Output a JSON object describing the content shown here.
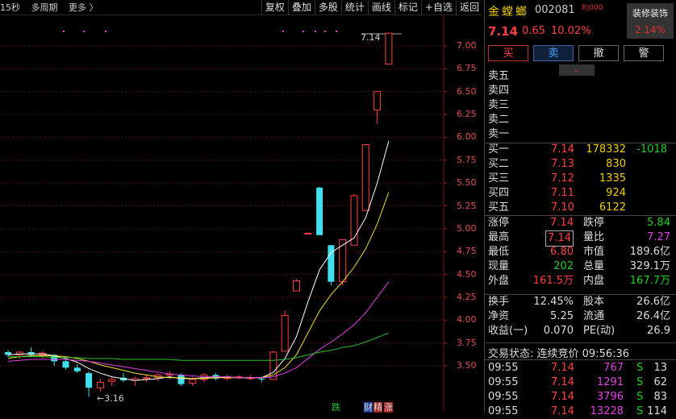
{
  "toolbar": {
    "left": [
      "15秒",
      "多周期",
      "更多 〉"
    ],
    "right": [
      "复权",
      "叠加",
      "多股",
      "统计",
      "画线",
      "+自选",
      "返回"
    ],
    "marker": "标记"
  },
  "chart": {
    "y_ticks": [
      "7.00",
      "6.75",
      "6.50",
      "6.25",
      "6.00",
      "5.75",
      "5.50",
      "5.25",
      "5.00",
      "4.75",
      "4.50",
      "4.25",
      "4.00",
      "3.75",
      "3.50"
    ],
    "high_label": "7.14",
    "low_label": "3.16",
    "bottom_tags": {
      "die": "跌",
      "cai": "财",
      "jing": "精",
      "zhang": "涨"
    }
  },
  "chart_data": {
    "type": "candlestick",
    "ylim": [
      3.3,
      7.3
    ],
    "candles": [
      {
        "o": 3.65,
        "h": 3.67,
        "l": 3.6,
        "c": 3.62
      },
      {
        "o": 3.62,
        "h": 3.66,
        "l": 3.58,
        "c": 3.65
      },
      {
        "o": 3.65,
        "h": 3.7,
        "l": 3.6,
        "c": 3.62
      },
      {
        "o": 3.62,
        "h": 3.66,
        "l": 3.58,
        "c": 3.64
      },
      {
        "o": 3.62,
        "h": 3.63,
        "l": 3.5,
        "c": 3.55
      },
      {
        "o": 3.55,
        "h": 3.58,
        "l": 3.46,
        "c": 3.48
      },
      {
        "o": 3.48,
        "h": 3.52,
        "l": 3.42,
        "c": 3.44
      },
      {
        "o": 3.42,
        "h": 3.44,
        "l": 3.16,
        "c": 3.26
      },
      {
        "o": 3.26,
        "h": 3.36,
        "l": 3.22,
        "c": 3.32
      },
      {
        "o": 3.33,
        "h": 3.38,
        "l": 3.28,
        "c": 3.35
      },
      {
        "o": 3.37,
        "h": 3.42,
        "l": 3.32,
        "c": 3.34
      },
      {
        "o": 3.34,
        "h": 3.38,
        "l": 3.28,
        "c": 3.36
      },
      {
        "o": 3.36,
        "h": 3.4,
        "l": 3.32,
        "c": 3.37
      },
      {
        "o": 3.37,
        "h": 3.42,
        "l": 3.33,
        "c": 3.4
      },
      {
        "o": 3.4,
        "h": 3.44,
        "l": 3.36,
        "c": 3.41
      },
      {
        "o": 3.4,
        "h": 3.42,
        "l": 3.28,
        "c": 3.3
      },
      {
        "o": 3.31,
        "h": 3.38,
        "l": 3.28,
        "c": 3.35
      },
      {
        "o": 3.35,
        "h": 3.42,
        "l": 3.32,
        "c": 3.4
      },
      {
        "o": 3.4,
        "h": 3.42,
        "l": 3.34,
        "c": 3.36
      },
      {
        "o": 3.36,
        "h": 3.4,
        "l": 3.34,
        "c": 3.38
      },
      {
        "o": 3.38,
        "h": 3.4,
        "l": 3.36,
        "c": 3.38
      },
      {
        "o": 3.36,
        "h": 3.4,
        "l": 3.34,
        "c": 3.37
      },
      {
        "o": 3.36,
        "h": 3.38,
        "l": 3.32,
        "c": 3.35
      },
      {
        "o": 3.35,
        "h": 3.66,
        "l": 3.35,
        "c": 3.65
      },
      {
        "o": 3.66,
        "h": 4.1,
        "l": 3.66,
        "c": 4.05
      },
      {
        "o": 4.32,
        "h": 4.45,
        "l": 4.32,
        "c": 4.43
      },
      {
        "o": 4.95,
        "h": 4.96,
        "l": 4.94,
        "c": 4.95
      },
      {
        "o": 5.45,
        "h": 5.46,
        "l": 4.93,
        "c": 4.93
      },
      {
        "o": 4.82,
        "h": 4.82,
        "l": 4.38,
        "c": 4.42
      },
      {
        "o": 4.42,
        "h": 4.88,
        "l": 4.38,
        "c": 4.88
      },
      {
        "o": 4.82,
        "h": 5.38,
        "l": 4.82,
        "c": 5.36
      },
      {
        "o": 5.2,
        "h": 5.92,
        "l": 5.2,
        "c": 5.92
      },
      {
        "o": 6.3,
        "h": 6.5,
        "l": 6.15,
        "c": 6.5
      },
      {
        "o": 6.8,
        "h": 7.14,
        "l": 6.8,
        "c": 7.14
      }
    ],
    "ma_series": [
      {
        "color": "#ffffff",
        "values": [
          3.62,
          3.63,
          3.63,
          3.63,
          3.61,
          3.58,
          3.54,
          3.47,
          3.42,
          3.38,
          3.36,
          3.34,
          3.35,
          3.36,
          3.38,
          3.36,
          3.36,
          3.37,
          3.37,
          3.38,
          3.37,
          3.37,
          3.37,
          3.43,
          3.58,
          3.82,
          4.2,
          4.55,
          4.74,
          4.82,
          4.9,
          5.12,
          5.5,
          5.96
        ]
      },
      {
        "color": "#f0e030",
        "values": [
          3.58,
          3.6,
          3.61,
          3.61,
          3.61,
          3.6,
          3.58,
          3.55,
          3.51,
          3.48,
          3.45,
          3.42,
          3.4,
          3.38,
          3.37,
          3.37,
          3.36,
          3.36,
          3.37,
          3.37,
          3.37,
          3.37,
          3.37,
          3.4,
          3.48,
          3.62,
          3.86,
          4.1,
          4.28,
          4.42,
          4.58,
          4.78,
          5.05,
          5.4
        ]
      },
      {
        "color": "#e040e0",
        "values": [
          3.55,
          3.56,
          3.57,
          3.57,
          3.57,
          3.57,
          3.56,
          3.55,
          3.53,
          3.51,
          3.49,
          3.47,
          3.45,
          3.43,
          3.41,
          3.4,
          3.39,
          3.38,
          3.38,
          3.38,
          3.37,
          3.37,
          3.37,
          3.38,
          3.42,
          3.48,
          3.58,
          3.68,
          3.76,
          3.85,
          3.95,
          4.08,
          4.25,
          4.42
        ]
      },
      {
        "color": "#30c030",
        "values": [
          3.6,
          3.6,
          3.6,
          3.6,
          3.59,
          3.59,
          3.59,
          3.58,
          3.58,
          3.58,
          3.57,
          3.57,
          3.57,
          3.57,
          3.57,
          3.56,
          3.56,
          3.56,
          3.56,
          3.56,
          3.56,
          3.56,
          3.56,
          3.56,
          3.57,
          3.59,
          3.62,
          3.65,
          3.67,
          3.7,
          3.72,
          3.76,
          3.81,
          3.86
        ]
      }
    ]
  },
  "quote": {
    "name": "金螳螂",
    "code": "002081",
    "tag": "R|000",
    "deco_title": "装修装饰",
    "deco_value": "2.14%",
    "price": "7.14",
    "change": "0.65",
    "change_pct": "10.02%",
    "buttons": {
      "buy": "买",
      "sell": "卖",
      "cancel": "撤",
      "alert": "警"
    },
    "collapse": "⌄",
    "asks": [
      {
        "label": "卖五",
        "price": "",
        "vol": ""
      },
      {
        "label": "卖四",
        "price": "",
        "vol": ""
      },
      {
        "label": "卖三",
        "price": "",
        "vol": ""
      },
      {
        "label": "卖二",
        "price": "",
        "vol": ""
      },
      {
        "label": "卖一",
        "price": "",
        "vol": ""
      }
    ],
    "bids": [
      {
        "label": "买一",
        "price": "7.14",
        "vol": "178332",
        "chg": "-1018"
      },
      {
        "label": "买二",
        "price": "7.13",
        "vol": "830",
        "chg": ""
      },
      {
        "label": "买三",
        "price": "7.12",
        "vol": "1335",
        "chg": ""
      },
      {
        "label": "买四",
        "price": "7.11",
        "vol": "924",
        "chg": ""
      },
      {
        "label": "买五",
        "price": "7.10",
        "vol": "6122",
        "chg": ""
      }
    ],
    "stats1": [
      {
        "l1": "涨停",
        "v1": "7.14",
        "c1": "red",
        "l2": "跌停",
        "v2": "5.84",
        "c2": "green"
      },
      {
        "l1": "最高",
        "v1": "7.14",
        "c1": "red",
        "l2": "量比",
        "v2": "7.27",
        "c2": "magenta"
      },
      {
        "l1": "最低",
        "v1": "6.80",
        "c1": "red",
        "l2": "市值",
        "v2": "189.6亿",
        "c2": "white"
      },
      {
        "l1": "现量",
        "v1": "202",
        "c1": "green",
        "l2": "总量",
        "v2": "329.1万",
        "c2": "white"
      },
      {
        "l1": "外盘",
        "v1": "161.5万",
        "c1": "red",
        "l2": "内盘",
        "v2": "167.7万",
        "c2": "green"
      }
    ],
    "stats2": [
      {
        "l1": "换手",
        "v1": "12.45%",
        "c1": "white",
        "l2": "股本",
        "v2": "26.6亿",
        "c2": "white"
      },
      {
        "l1": "净资",
        "v1": "5.25",
        "c1": "white",
        "l2": "流通",
        "v2": "26.4亿",
        "c2": "white"
      },
      {
        "l1": "收益(一)",
        "v1": "0.070",
        "c1": "white",
        "l2": "PE(动)",
        "v2": "26.9",
        "c2": "white"
      }
    ],
    "status": "交易状态: 连续竞价 09:56:36",
    "ticks": [
      {
        "time": "09:55",
        "price": "7.14",
        "vol": "767",
        "side": "S",
        "n": "13"
      },
      {
        "time": "09:55",
        "price": "7.14",
        "vol": "1291",
        "side": "S",
        "n": "62"
      },
      {
        "time": "09:55",
        "price": "7.14",
        "vol": "3796",
        "side": "S",
        "n": "83"
      },
      {
        "time": "09:55",
        "price": "7.14",
        "vol": "13228",
        "side": "S",
        "n": "114"
      }
    ]
  }
}
